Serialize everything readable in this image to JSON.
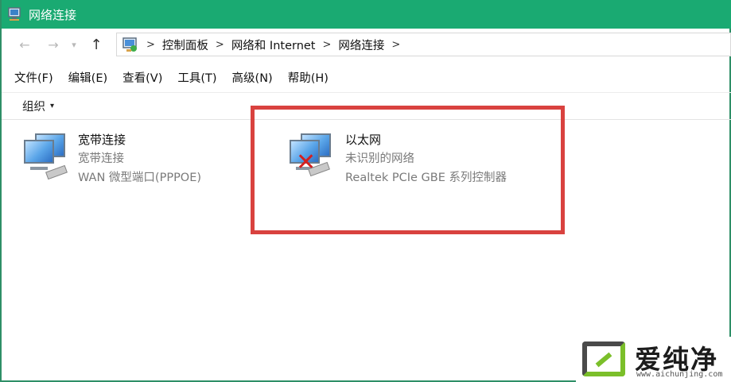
{
  "window": {
    "title": "网络连接",
    "title_bar_color": "#1aaa72"
  },
  "nav": {
    "back_icon": "arrow-left",
    "forward_icon": "arrow-right",
    "recent_icon": "chevron-down",
    "up_icon": "arrow-up"
  },
  "address": {
    "separator": ">",
    "crumbs": [
      "控制面板",
      "网络和 Internet",
      "网络连接"
    ]
  },
  "menu": {
    "items": [
      "文件(F)",
      "编辑(E)",
      "查看(V)",
      "工具(T)",
      "高级(N)",
      "帮助(H)"
    ]
  },
  "toolbar": {
    "organize_label": "组织",
    "organize_caret": "▾"
  },
  "connections": [
    {
      "name": "宽带连接",
      "type": "宽带连接",
      "device": "WAN 微型端口(PPPOE)",
      "status_icon": "broadband-connection-icon"
    },
    {
      "name": "以太网",
      "type": "未识别的网络",
      "device": "Realtek PCIe GBE 系列控制器",
      "status_icon": "ethernet-disconnected-icon"
    }
  ],
  "highlight_color": "#d9423f",
  "watermark": {
    "text": "爱纯净",
    "url": "www.aichunjing.com"
  }
}
